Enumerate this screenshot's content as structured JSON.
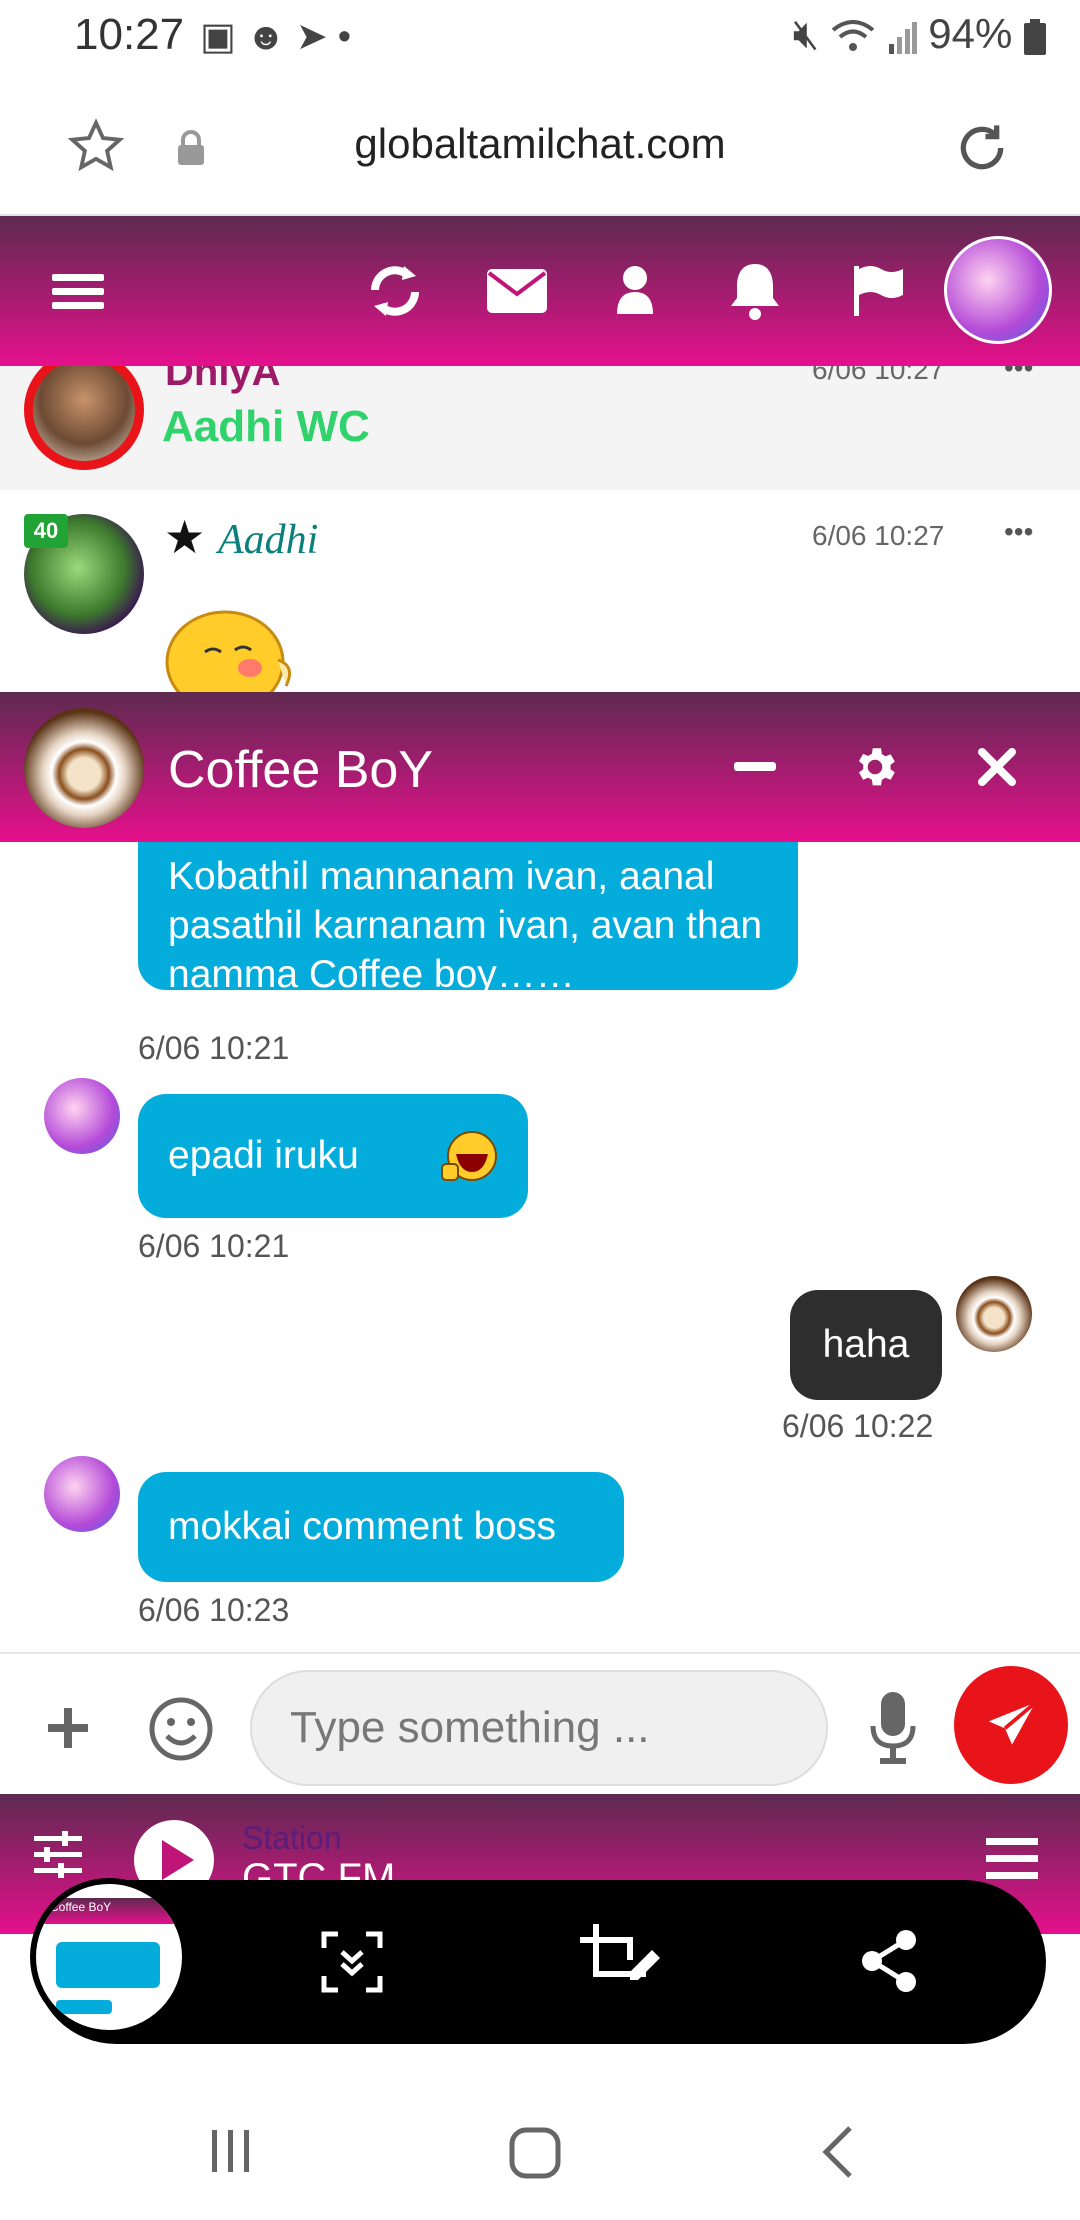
{
  "status_bar": {
    "time": "10:27",
    "notification_icons": [
      "image-icon",
      "face-icon",
      "telegram-icon",
      "dot-icon"
    ],
    "battery": "94%"
  },
  "browser": {
    "url": "globaltamilchat.com"
  },
  "app_header": {
    "icons": [
      "menu-icon",
      "refresh-icon",
      "mail-icon",
      "user-icon",
      "bell-icon",
      "flag-icon"
    ],
    "accent_gradient": [
      "#5e2a50",
      "#e5108c"
    ]
  },
  "feed": {
    "posts": [
      {
        "name": "DhiyA",
        "message": "Aadhi WC",
        "time": "6/06 10:27"
      },
      {
        "level": "40",
        "name": "Aadhi",
        "time": "6/06 10:27"
      }
    ]
  },
  "chat": {
    "title": "Coffee BoY",
    "messages": [
      {
        "text": "Kobathil mannanam ivan, aanal pasathil karnanam ivan, avan than namma Coffee boy……",
        "time": "6/06 10:21",
        "mine": false
      },
      {
        "text": "epadi iruku",
        "time": "6/06 10:21",
        "mine": false
      },
      {
        "text": "haha",
        "time": "6/06 10:22",
        "mine": true
      },
      {
        "text": "mokkai comment boss",
        "time": "6/06 10:23",
        "mine": false
      }
    ],
    "bubble_color": "#04acdc",
    "my_bubble_color": "#2e2e2e"
  },
  "input": {
    "placeholder": "Type something ...",
    "send_color": "#e8141a"
  },
  "player": {
    "label": "Station",
    "station": "GTC FM"
  },
  "screenshot_toolbar": {
    "thumbnail_title": "Coffee BoY"
  }
}
